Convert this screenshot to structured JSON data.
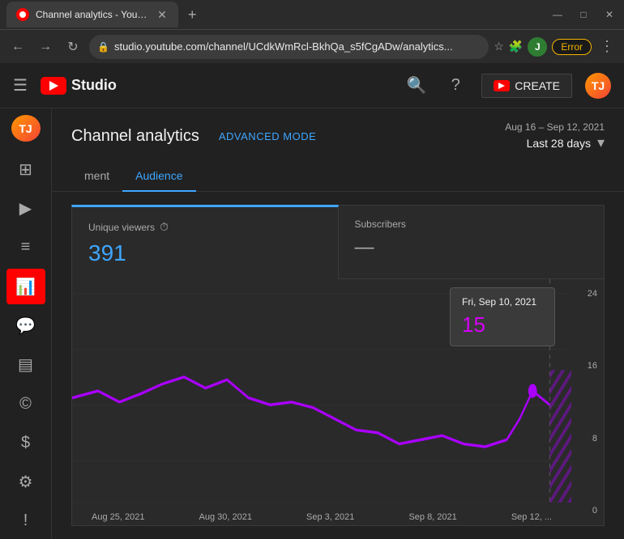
{
  "browser": {
    "tab_title": "Channel analytics - YouTube Stu...",
    "url": "studio.youtube.com/channel/UCdkWmRcl-BkhQa_s5fCgADw/analytics...",
    "error_badge": "Error"
  },
  "header": {
    "logo_text": "Studio",
    "create_label": "CREATE",
    "user_initials": "TJ"
  },
  "page": {
    "title": "Channel analytics",
    "advanced_mode": "ADVANCED MODE",
    "date_range": "Aug 16 – Sep 12, 2021",
    "date_label": "Last 28 days"
  },
  "tabs": [
    {
      "label": "ment",
      "active": false
    },
    {
      "label": "Audience",
      "active": true
    }
  ],
  "stats": {
    "unique_viewers_label": "Unique viewers",
    "unique_viewers_value": "391",
    "subscribers_label": "Subscribers",
    "subscribers_value": "—"
  },
  "tooltip": {
    "date": "Fri, Sep 10, 2021",
    "value": "15"
  },
  "chart": {
    "y_labels": [
      "24",
      "16",
      "8",
      "0"
    ],
    "x_labels": [
      "Aug 25, 2021",
      "Aug 30, 2021",
      "Sep 3, 2021",
      "Sep 8, 2021",
      "Sep 12, ..."
    ]
  },
  "sidebar": {
    "avatar_initials": "TJ",
    "items": [
      {
        "icon": "⊞",
        "name": "dashboard"
      },
      {
        "icon": "▶",
        "name": "content"
      },
      {
        "icon": "☰",
        "name": "playlists"
      },
      {
        "icon": "📊",
        "name": "analytics",
        "active": true
      },
      {
        "icon": "💬",
        "name": "comments"
      },
      {
        "icon": "📋",
        "name": "subtitles"
      },
      {
        "icon": "©",
        "name": "copyright"
      },
      {
        "icon": "$",
        "name": "monetization"
      },
      {
        "icon": "⚙",
        "name": "settings"
      },
      {
        "icon": "!",
        "name": "feedback"
      }
    ]
  }
}
